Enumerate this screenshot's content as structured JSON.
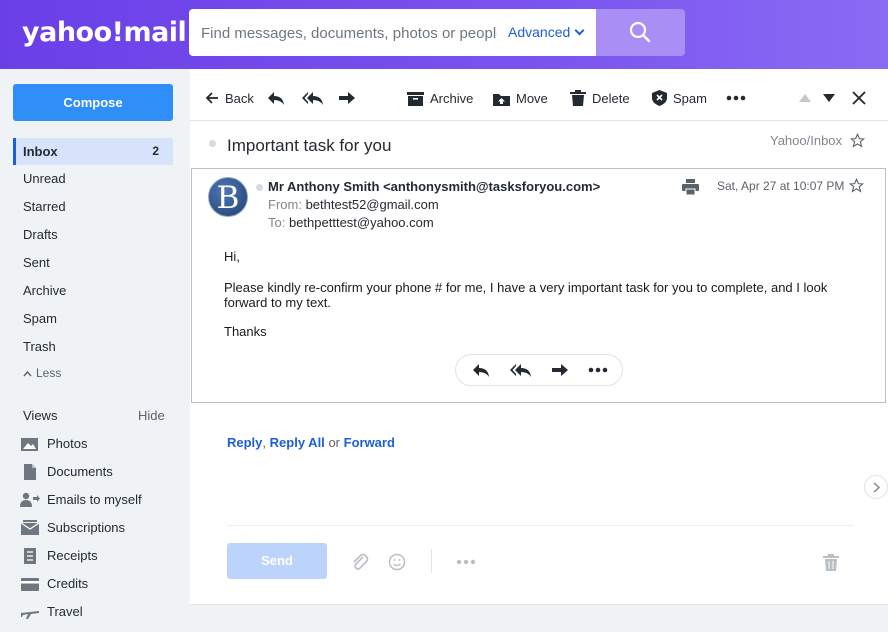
{
  "brand": {
    "logo_text": "yahoo!mail"
  },
  "search": {
    "placeholder": "Find messages, documents, photos or people",
    "advanced_label": "Advanced"
  },
  "sidebar": {
    "compose_label": "Compose",
    "folders": [
      {
        "label": "Inbox",
        "count": "2"
      },
      {
        "label": "Unread"
      },
      {
        "label": "Starred"
      },
      {
        "label": "Drafts"
      },
      {
        "label": "Sent"
      },
      {
        "label": "Archive"
      },
      {
        "label": "Spam"
      },
      {
        "label": "Trash"
      }
    ],
    "less_label": "Less",
    "views_title": "Views",
    "hide_label": "Hide",
    "views": [
      {
        "label": "Photos",
        "icon": "photo-icon"
      },
      {
        "label": "Documents",
        "icon": "document-icon"
      },
      {
        "label": "Emails to myself",
        "icon": "person-arrow-icon"
      },
      {
        "label": "Subscriptions",
        "icon": "subscriptions-icon"
      },
      {
        "label": "Receipts",
        "icon": "receipt-icon"
      },
      {
        "label": "Credits",
        "icon": "credit-card-icon"
      },
      {
        "label": "Travel",
        "icon": "plane-icon"
      }
    ]
  },
  "toolbar": {
    "back_label": "Back",
    "archive_label": "Archive",
    "move_label": "Move",
    "delete_label": "Delete",
    "spam_label": "Spam"
  },
  "message": {
    "subject": "Important task for you",
    "folder": "Yahoo/Inbox",
    "avatar_letter": "B",
    "sender": "Mr Anthony Smith <anthonysmith@tasksforyou.com>",
    "from_label": "From:",
    "from_value": "bethtest52@gmail.com",
    "to_label": "To:",
    "to_value": "bethpetttest@yahoo.com",
    "date": "Sat, Apr 27 at 10:07 PM",
    "greeting": "Hi,",
    "body": "Please kindly re-confirm your phone # for me, I have a very important task for you to complete, and I look forward to my text.",
    "closing": "Thanks"
  },
  "reply": {
    "reply_label": "Reply",
    "comma": ",",
    "reply_all_label": "Reply All",
    "or_label": "or",
    "forward_label": "Forward",
    "send_label": "Send"
  },
  "colors": {
    "header": "#6b3fe8",
    "accent": "#1d5fd6",
    "compose": "#2f8ef7"
  }
}
